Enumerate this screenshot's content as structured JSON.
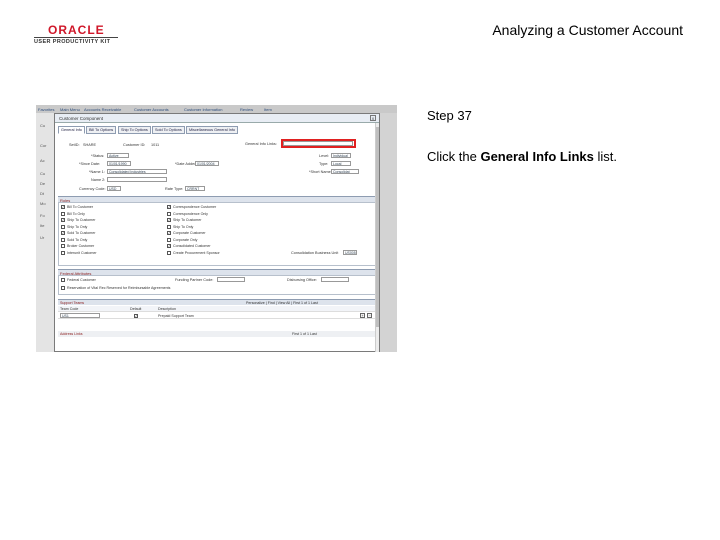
{
  "logo": {
    "word": "ORACLE",
    "sub": "USER PRODUCTIVITY KIT"
  },
  "slide_title": "Analyzing a Customer Account",
  "step": "Step 37",
  "instruction": {
    "prefix": "Click the ",
    "target": "General Info Links",
    "suffix": " list."
  },
  "app": {
    "nav": [
      "Favorites",
      "Main Menu",
      "Accounts Receivable",
      "Customer Accounts",
      "Customer Information",
      "Review",
      "Item"
    ],
    "left_labels": [
      "Cu",
      "Cor",
      "Ac",
      "Cu",
      "De",
      "Dt",
      "Mo",
      "Fo",
      "Ite",
      "Ur"
    ],
    "dialog_title": "Customer Component",
    "close": "X",
    "tabs": [
      "General Info",
      "Bill To Options",
      "Ship To Options",
      "Sold To Options",
      "Miscellaneous General Info"
    ],
    "fields": {
      "setid_label": "SetID:",
      "setid_value": "SHARE",
      "customer_id_label": "Customer ID:",
      "customer_id_value": "1011",
      "general_info_links_label": "General Info Links:",
      "status_label": "*Status:",
      "status_value": "Active",
      "level_label": "Level:",
      "level_value": "Individual",
      "since_label": "*Since Date:",
      "since_value": "01/01/1990",
      "added_label": "*Date Added:",
      "added_value": "01/01/2004",
      "type_label": "Type:",
      "type_value": "Local",
      "name1_label": "*Name 1:",
      "name1_value": "Consolidated Industries",
      "name2_label": "Name 2:",
      "short_label": "*Short Name:",
      "short_value": "Consolidat",
      "currency_label": "Currency Code:",
      "currency_value": "USD",
      "rate_label": "Rate Type:",
      "rate_value": "CRRNT"
    },
    "roles_section": "Roles",
    "roles_left": [
      "Bill To Customer",
      "Bill To Only",
      "Ship To Customer",
      "Ship To Only",
      "Sold To Customer",
      "Sold To Only",
      "Broker Customer",
      "Interunit Customer"
    ],
    "roles_left_checked": [
      true,
      false,
      true,
      false,
      true,
      false,
      false,
      false
    ],
    "roles_right": [
      "Correspondence Customer",
      "Correspondence Only",
      "Ship To Customer",
      "Ship To Only",
      "Corporate Customer",
      "Corporate Only",
      "Consolidated Customer",
      "Create Procurement Sponsor"
    ],
    "roles_right_checked": [
      true,
      false,
      true,
      false,
      true,
      false,
      true,
      false
    ],
    "consolidated_label": "Consolidation Business Unit",
    "consolidated_value": "US005",
    "federal_section": "Federal Attributes",
    "federal_cb": "Federal Customer",
    "funding_label": "Funding Partner Code:",
    "disbursing_label": "Disbursing Office:",
    "reimb_cb": "Reservation of Vital Rec Reserved for Reimbursable Agreements",
    "grid_title": "Support Teams",
    "grid_nav": "Personalize | Find | View All |    First  1 of 1  Last",
    "grid_cols": [
      "Team Code",
      "Default",
      "Description"
    ],
    "grid_row": [
      "US1",
      "",
      "Prepaid Support Team"
    ],
    "footer": "Address Links",
    "footer_right": "First   1 of 1   Last"
  }
}
